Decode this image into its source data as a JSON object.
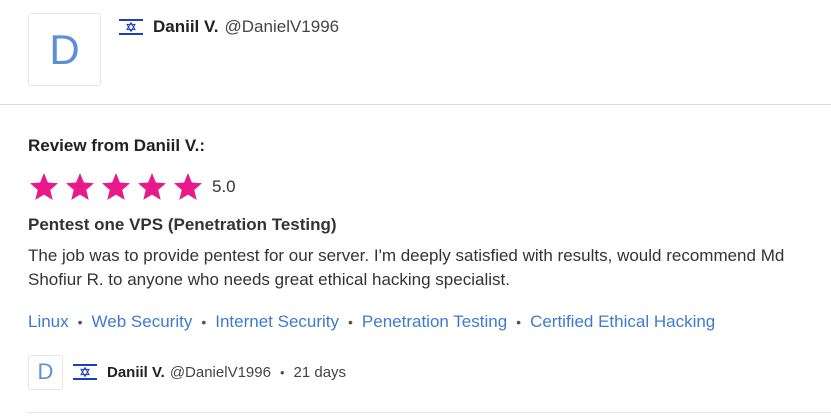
{
  "reviewer": {
    "initial": "D",
    "name": "Daniil V.",
    "handle": "@DanielV1996",
    "country_flag": "israel-flag-icon"
  },
  "review": {
    "heading": "Review from Daniil V.:",
    "rating": 5.0,
    "rating_text": "5.0",
    "star_color": "#e8198b",
    "job_title": "Pentest one VPS (Penetration Testing)",
    "body": "The job was to provide pentest for our server. I'm deeply satisfied with results, would recommend Md Shofiur R. to anyone who needs great ethical hacking specialist."
  },
  "tags": [
    "Linux",
    "Web Security",
    "Internet Security",
    "Penetration Testing",
    "Certified Ethical Hacking"
  ],
  "tag_separator": "•",
  "footer": {
    "initial": "D",
    "name": "Daniil V.",
    "handle": "@DanielV1996",
    "separator": "•",
    "time_ago": "21 days"
  },
  "colors": {
    "link": "#3e7bcf",
    "avatar_letter": "#5b8fd9",
    "flag_blue": "#1d3fbf"
  }
}
